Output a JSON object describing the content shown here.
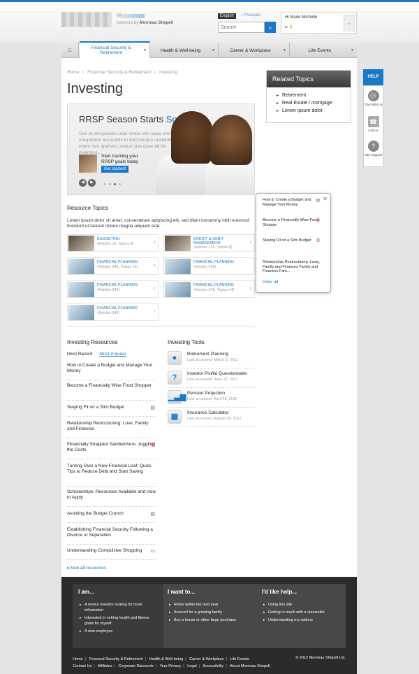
{
  "header": {
    "logo_for": "for",
    "powered_by": "powered by",
    "powered_brand": "Morneau Shepell",
    "lang_active": "English",
    "lang_other": "Français",
    "search_placeholder": "Search",
    "user_greeting": "Hi Marie-Michelle"
  },
  "nav": {
    "items": [
      {
        "label": "Financial Security & Retirement"
      },
      {
        "label": "Health & Well-being"
      },
      {
        "label": "Career & Workplace"
      },
      {
        "label": "Life Events"
      }
    ]
  },
  "breadcrumb": [
    "Home",
    "›",
    "Financial Security & Retirement",
    "›",
    "Investing"
  ],
  "page_title": "Investing",
  "hero": {
    "title_a": "RRSP Season Starts",
    "title_b": "Soon",
    "body": "Sed ut perspiciatis unde omnis iste natus error sit voluptatem accusantium doloremque laudantium, totam rem aperiam, eaque ipsa quae ab illo inventore...",
    "promo_text": "Start tracking your RRSP goals today",
    "promo_button": "Get started!",
    "prev": "◀",
    "next": "▶"
  },
  "related_topics": {
    "title": "Related Topics",
    "items": [
      "Retirement",
      "Real Estate / mortgage",
      "Lorem ipsum dolor"
    ]
  },
  "help": {
    "title": "HELP",
    "items": [
      "Chat With Us",
      "Call Us",
      "Site Support"
    ]
  },
  "resource_topics": {
    "title": "Resource Topics",
    "description": "Lorem ipsum dolor sit amet, consectetuer adipiscing elit, sed diam nonummy nibh euismod tincidunt ut laoreet dolore magna aliquam erat.",
    "tiles": [
      {
        "name": "BUDGETING",
        "meta": "(Articles 16, Topics 8)"
      },
      {
        "name": "CREDIT & DEBIT MANAGEMENT",
        "meta": "(Articles 125, Topics 8)"
      },
      {
        "name": "FINANCIAL PLANNING",
        "meta": "(Articles 345, Topics 14)"
      },
      {
        "name": "FINANCIAL PLANNING",
        "meta": "(Articles 345)"
      },
      {
        "name": "FINANCIAL PLANNING",
        "meta": "(Articles 345)"
      },
      {
        "name": "FINANCIAL PLANNING",
        "meta": "(Articles 345, Topics 14)"
      },
      {
        "name": "FINANCIAL PLANNING",
        "meta": "(Articles 345)"
      }
    ]
  },
  "popup": {
    "items": [
      "How to Create a Budget and Manage Your Money",
      "Become a Financially Wise Food Shopper",
      "Staying Fit on a Slim Budget",
      "Relationship Restructuring: Love, Family and Finances Family and Finances Fam..."
    ],
    "view_all": "View all",
    "close": "✕"
  },
  "investing_resources": {
    "title": "Investing Resources",
    "tab_recent": "Most Recent",
    "tab_popular": "Most Popular",
    "items": [
      "How to Create a Budget and Manage Your Money",
      "Become a Financially Wise Food Shopper",
      "Staying Fit on a Slim Budget",
      "Relationship Restructuring: Love, Family and Finances",
      "Financially Strapped Sandwichers: Juggling the Costs",
      "Turning Over a New Financial Leaf: Quick Tips to Reduce Debt and Start Saving",
      "Scholarships: Resources Available and How to Apply",
      "Avoiding the Budget Crunch",
      "Establishing Financial Security Following a Divorce or Seperation",
      "Understanding Compulsive Shopping"
    ],
    "view_all": "View all resources"
  },
  "investing_tools": {
    "title": "Investing Tools",
    "items": [
      {
        "name": "Retirement Planning",
        "accessed": "Last accessed: March 8, 2011"
      },
      {
        "name": "Investor Profile Questionnaire",
        "accessed": "Last accessed: June 22, 2011"
      },
      {
        "name": "Pension Projection",
        "accessed": "Last accessed: April 23, 2011"
      },
      {
        "name": "Insurance Calculator",
        "accessed": "Last accessed: August 20, 2011"
      }
    ]
  },
  "footer": {
    "col1": {
      "title": "I am...",
      "items": [
        "A novice investor looking for more information",
        "Interested in setting health and fitness goals for myself",
        "A new employee"
      ]
    },
    "col2": {
      "title": "I want to...",
      "items": [
        "Retire within the next year",
        "Account for a growing family",
        "Buy a house or other large purchase"
      ]
    },
    "col3": {
      "title": "I'd like help...",
      "items": [
        "Using this site",
        "Getting in touch with a counsellor",
        "Understanding my options"
      ]
    },
    "links_row1": [
      "Home",
      "Financial Security & Retirement",
      "Health & Well-being",
      "Career & Workplace",
      "Life Events"
    ],
    "links_row2": [
      "Contact Us",
      "Affiliates",
      "Corporate Discounts",
      "Your Privacy",
      "Legal",
      "Accessibility",
      "About Morneau Shepell"
    ],
    "copyright": "© 2012 Morneau Shepell Ltd."
  }
}
